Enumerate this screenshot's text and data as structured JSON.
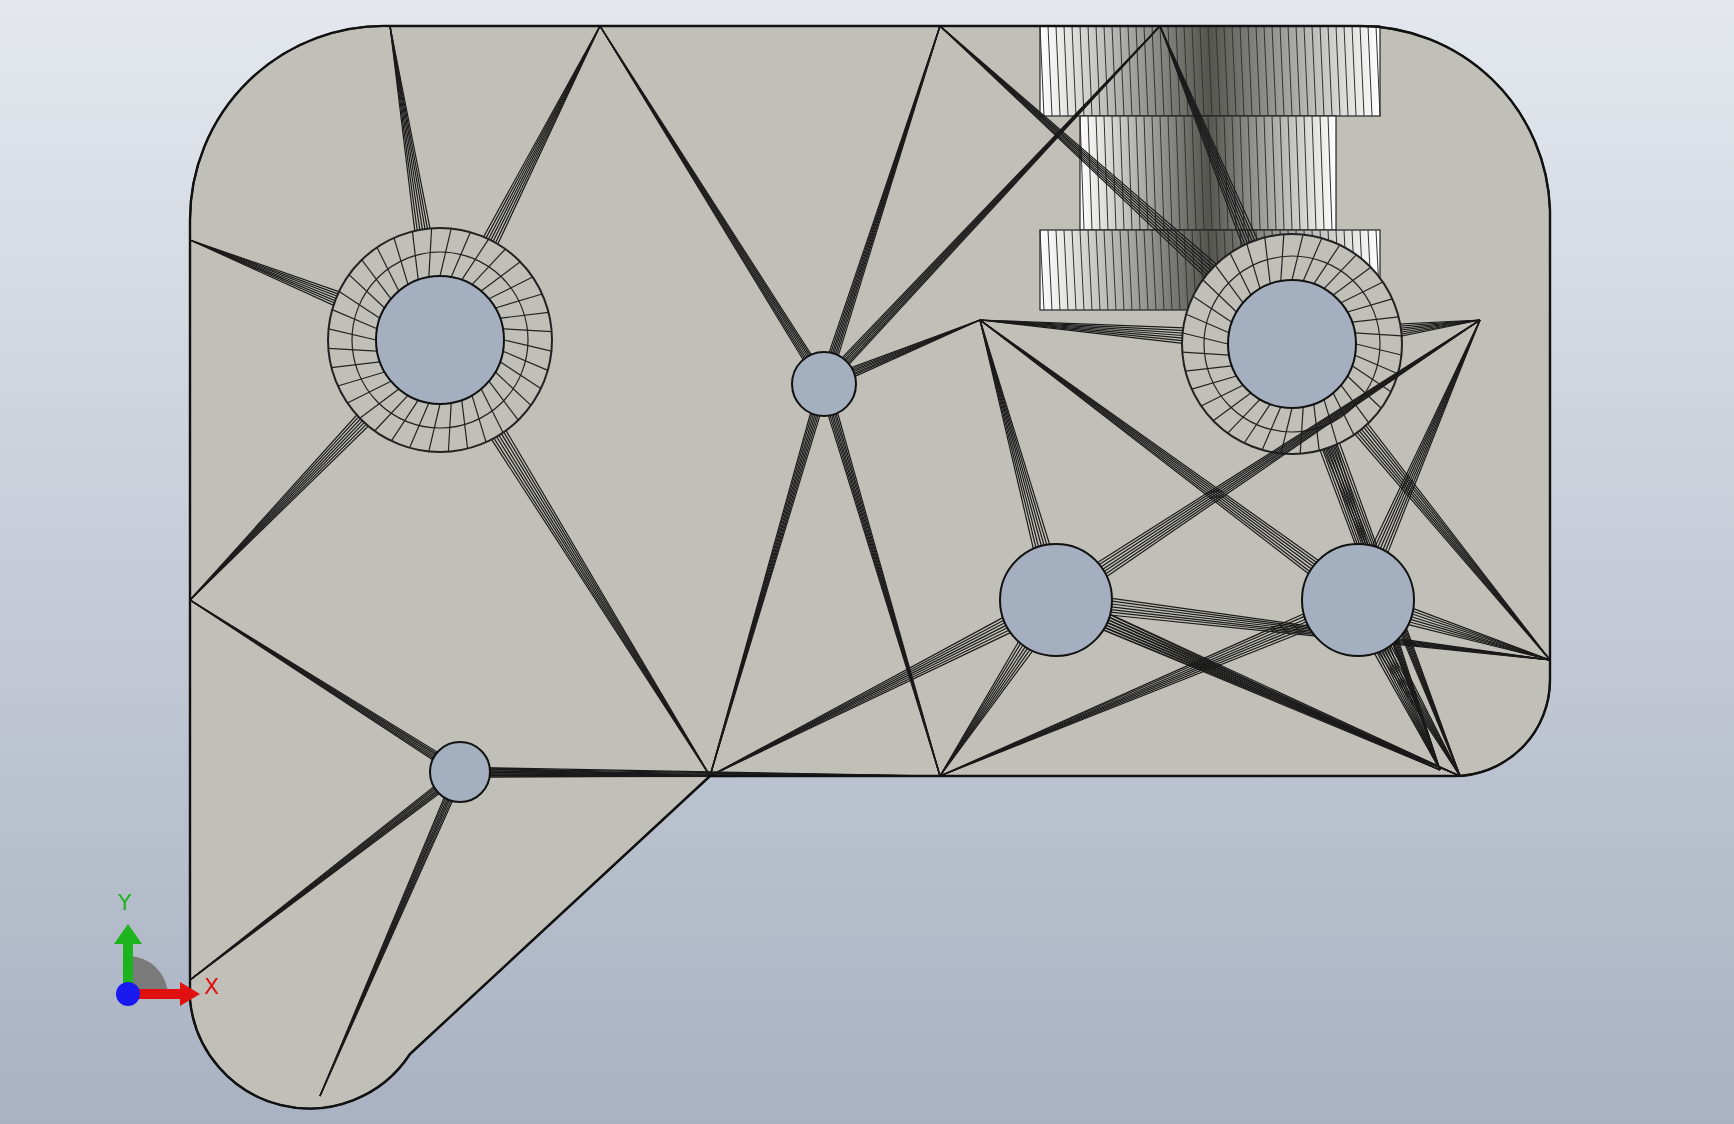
{
  "viewport": {
    "axis_triad": {
      "x_label": "X",
      "y_label": "Y"
    }
  }
}
